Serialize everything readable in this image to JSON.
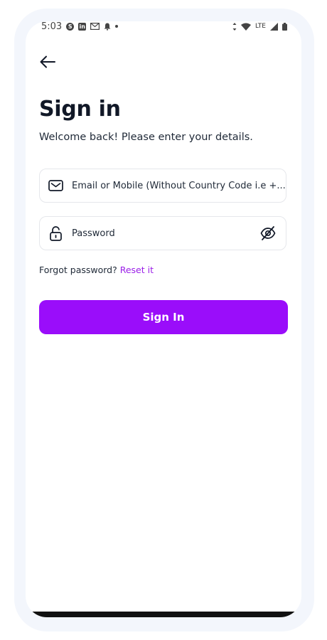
{
  "status_bar": {
    "time": "5:03",
    "network": "LTE",
    "icons": [
      "skype-icon",
      "linkedin-icon",
      "gmail-icon",
      "bell-icon",
      "dot-icon",
      "vibrate-icon",
      "wifi-icon",
      "signal-icon",
      "battery-icon"
    ]
  },
  "header": {
    "back_icon": "arrow-left-icon",
    "title": "Sign in",
    "subtitle": "Welcome back! Please enter your details."
  },
  "form": {
    "email": {
      "icon": "mail-icon",
      "placeholder": "Email or Mobile (Without Country Code i.e +...",
      "value": ""
    },
    "password": {
      "icon": "lock-icon",
      "placeholder": "Password",
      "value": "",
      "toggle_icon": "eye-off-icon"
    },
    "forgot_text": "Forgot password?",
    "reset_link": "Reset it",
    "submit_label": "Sign In"
  },
  "colors": {
    "accent": "#9a0dfa",
    "link": "#9b1fe8",
    "text": "#1f2937"
  }
}
